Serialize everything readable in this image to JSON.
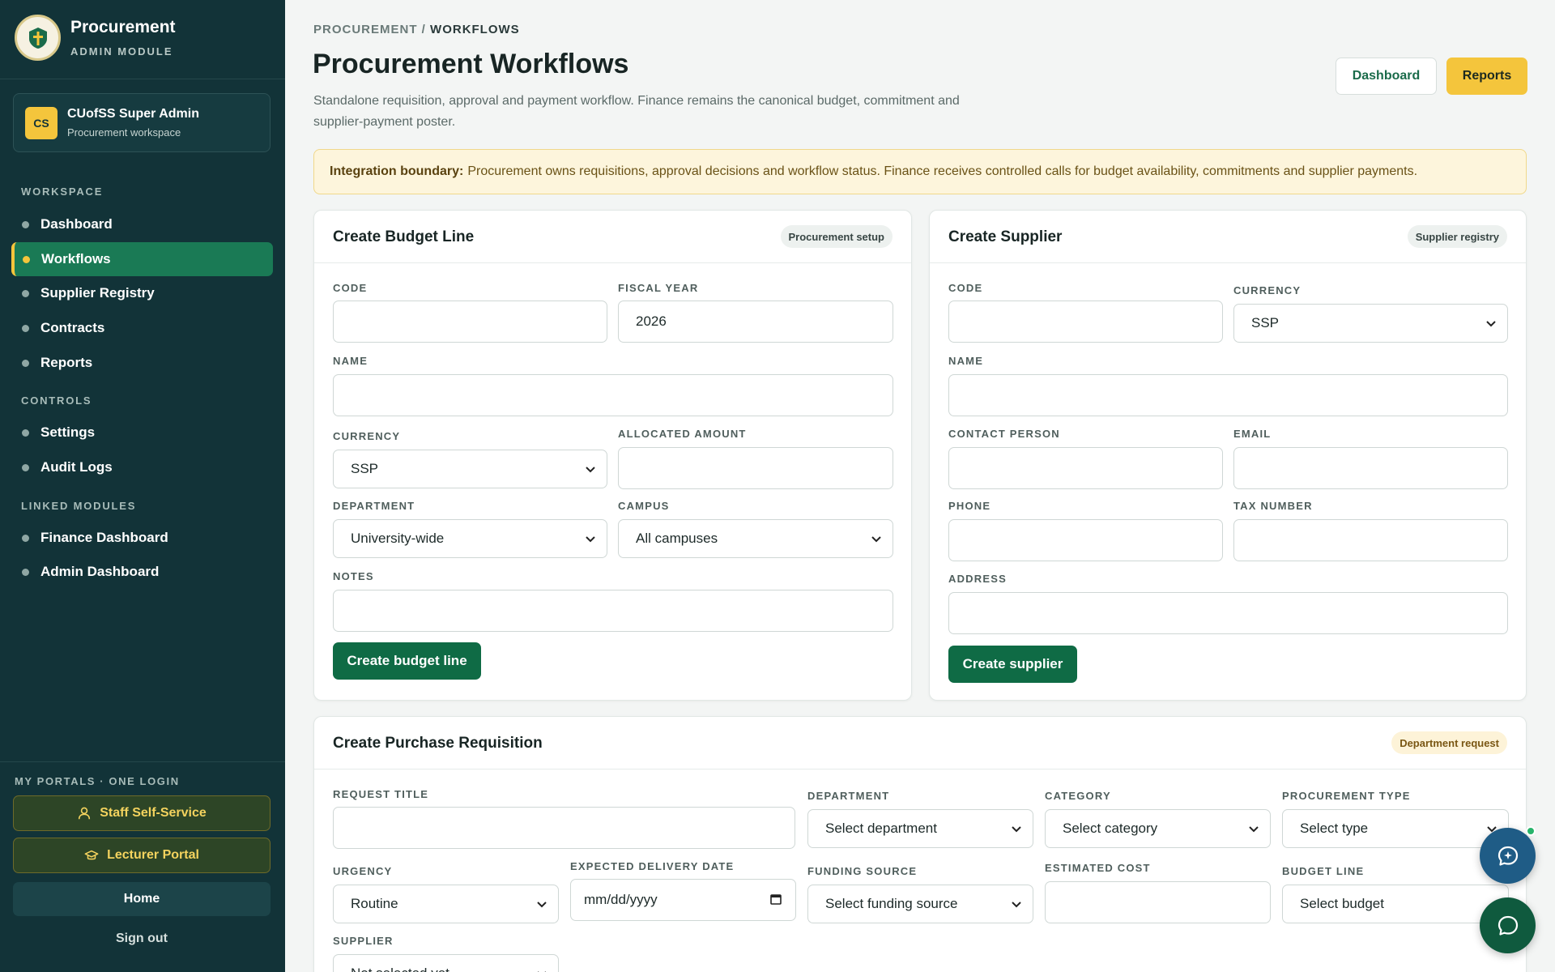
{
  "brand": {
    "title": "Procurement",
    "subtitle": "ADMIN MODULE"
  },
  "user": {
    "initials": "CS",
    "name": "CUofSS Super Admin",
    "workspace": "Procurement workspace"
  },
  "nav": {
    "workspace_label": "WORKSPACE",
    "workspace_items": [
      "Dashboard",
      "Workflows",
      "Supplier Registry",
      "Contracts",
      "Reports"
    ],
    "controls_label": "CONTROLS",
    "controls_items": [
      "Settings",
      "Audit Logs"
    ],
    "linked_label": "LINKED MODULES",
    "linked_items": [
      "Finance Dashboard",
      "Admin Dashboard"
    ],
    "active": "Workflows"
  },
  "portals": {
    "label": "MY PORTALS · ONE LOGIN",
    "staff": "Staff Self-Service",
    "lecturer": "Lecturer Portal",
    "home": "Home",
    "signout": "Sign out"
  },
  "header": {
    "breadcrumb_root": "PROCUREMENT",
    "breadcrumb_sep": " / ",
    "breadcrumb_current": "WORKFLOWS",
    "title": "Procurement Workflows",
    "description": "Standalone requisition, approval and payment workflow. Finance remains the canonical budget, commitment and supplier-payment poster.",
    "dashboard_btn": "Dashboard",
    "reports_btn": "Reports"
  },
  "notice": {
    "label": "Integration boundary:",
    "text": "Procurement owns requisitions, approval decisions and workflow status. Finance receives controlled calls for budget availability, commitments and supplier payments."
  },
  "budget_card": {
    "title": "Create Budget Line",
    "badge": "Procurement setup",
    "code_label": "CODE",
    "code_value": "",
    "fiscal_label": "FISCAL YEAR",
    "fiscal_value": "2026",
    "name_label": "NAME",
    "name_value": "",
    "currency_label": "CURRENCY",
    "currency_value": "SSP",
    "amount_label": "ALLOCATED AMOUNT",
    "amount_value": "",
    "department_label": "DEPARTMENT",
    "department_value": "University-wide",
    "campus_label": "CAMPUS",
    "campus_value": "All campuses",
    "notes_label": "NOTES",
    "notes_value": "",
    "submit": "Create budget line"
  },
  "supplier_card": {
    "title": "Create Supplier",
    "badge": "Supplier registry",
    "code_label": "CODE",
    "currency_label": "CURRENCY",
    "currency_value": "SSP",
    "name_label": "NAME",
    "contact_label": "CONTACT PERSON",
    "email_label": "EMAIL",
    "phone_label": "PHONE",
    "tax_label": "TAX NUMBER",
    "address_label": "ADDRESS",
    "submit": "Create supplier"
  },
  "requisition_card": {
    "title": "Create Purchase Requisition",
    "badge": "Department request",
    "request_title_label": "REQUEST TITLE",
    "department_label": "DEPARTMENT",
    "department_value": "Select department",
    "category_label": "CATEGORY",
    "category_value": "Select category",
    "type_label": "PROCUREMENT TYPE",
    "type_value": "Select type",
    "urgency_label": "URGENCY",
    "urgency_value": "Routine",
    "delivery_label": "EXPECTED DELIVERY DATE",
    "delivery_placeholder": "mm/dd/yyyy",
    "funding_label": "FUNDING SOURCE",
    "funding_value": "Select funding source",
    "cost_label": "ESTIMATED COST",
    "budget_line_label": "BUDGET LINE",
    "budget_line_value": "Select budget",
    "supplier_label": "SUPPLIER",
    "supplier_value": "Not selected yet"
  },
  "icons": {
    "logo": "crest-cross-icon",
    "staff": "person-icon",
    "lecturer": "graduation-cap-icon",
    "assistant_fab": "chat-sparkle-icon",
    "chat_fab": "chat-bubble-icon",
    "select": "chevron-down-icon",
    "date": "calendar-icon"
  },
  "colors": {
    "sidebar": "#123338",
    "active_nav": "#1a7a55",
    "accent_yellow": "#f4c53c",
    "primary_green": "#0f6b45",
    "assistant_fab": "#1f5c86",
    "chat_fab": "#0f5a3e",
    "online_dot": "#27b36a"
  }
}
